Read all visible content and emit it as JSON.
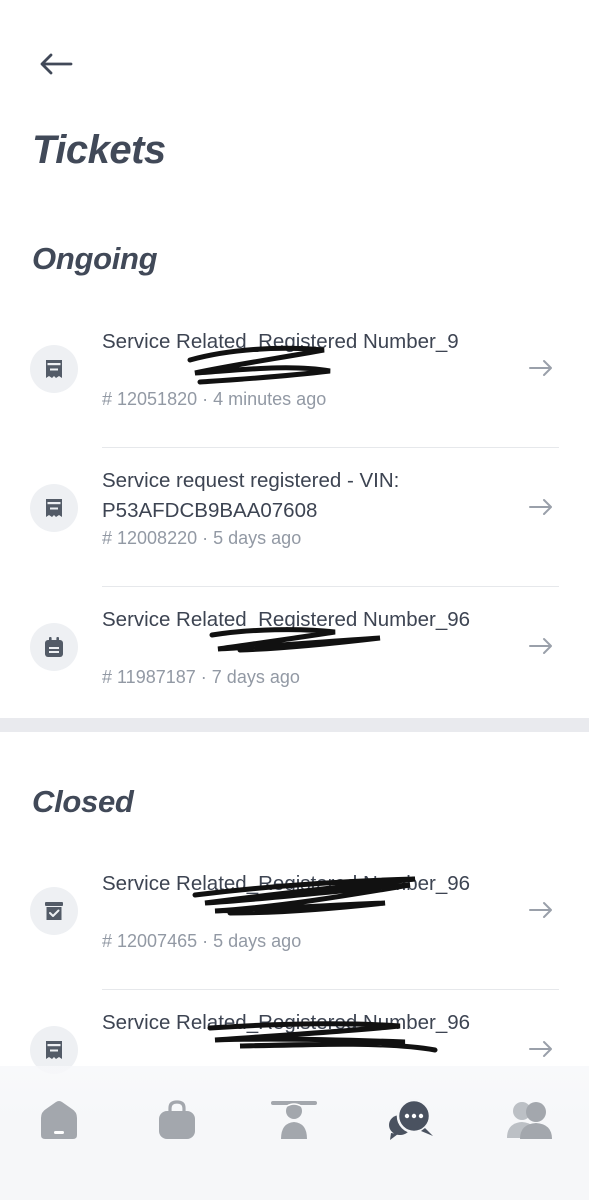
{
  "header": {
    "title": "Tickets"
  },
  "sections": {
    "ongoing": {
      "title": "Ongoing",
      "tickets": [
        {
          "title": "Service Related_Registered Number_9",
          "number": "# 12051820",
          "age": "4 minutes ago",
          "icon": "receipt-icon"
        },
        {
          "title": "Service request registered - VIN: P53AFDCB9BAA07608",
          "number": "# 12008220",
          "age": "5 days ago",
          "icon": "receipt-icon"
        },
        {
          "title": "Service Related_Registered Number_96",
          "number": "# 11987187",
          "age": "7 days ago",
          "icon": "calendar-icon"
        }
      ]
    },
    "closed": {
      "title": "Closed",
      "tickets": [
        {
          "title": "Service Related_Registered Number_96",
          "number": "# 12007465",
          "age": "5 days ago",
          "icon": "receipt-check-icon"
        },
        {
          "title": "Service Related_Registered Number_96",
          "number": "",
          "age": "",
          "icon": "receipt-icon"
        }
      ]
    }
  },
  "separator": "·",
  "colors": {
    "text": "#3d4452",
    "muted": "#9299a4",
    "icon": "#535b67",
    "nav_icon": "#a3a7ad",
    "nav_active": "#4a5260"
  },
  "bottom_nav": [
    {
      "icon": "home-icon",
      "active": false
    },
    {
      "icon": "bag-icon",
      "active": false
    },
    {
      "icon": "rider-icon",
      "active": false
    },
    {
      "icon": "chat-icon",
      "active": true
    },
    {
      "icon": "profile-icon",
      "active": false
    }
  ]
}
